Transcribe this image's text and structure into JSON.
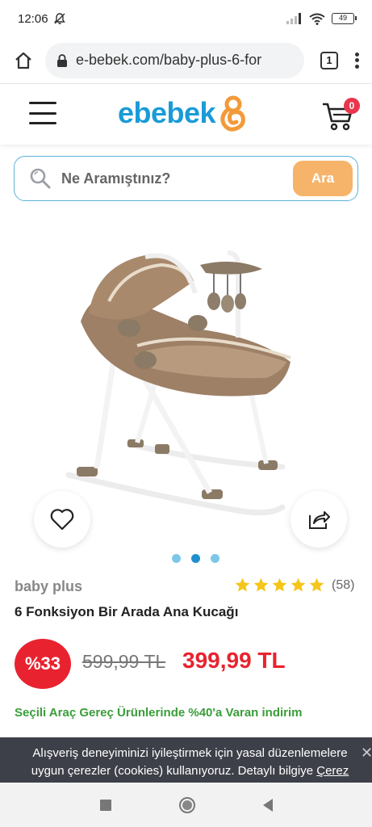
{
  "status_bar": {
    "time": "12:06",
    "battery": "49"
  },
  "browser": {
    "url": "e-bebek.com/baby-plus-6-for",
    "tab_count": "1"
  },
  "site": {
    "logo": "ebebek",
    "cart_count": "0",
    "brand_color": "#1a9bd7",
    "accent_color": "#f29a3a"
  },
  "search": {
    "placeholder": "Ne Aramıştınız?",
    "button_label": "Ara"
  },
  "gallery": {
    "dots": 3,
    "active_index": 1
  },
  "product": {
    "brand": "baby plus",
    "rating": 5,
    "review_count": "(58)",
    "title": "6 Fonksiyon Bir Arada Ana Kucağı",
    "discount": "%33",
    "old_price": "599,99 TL",
    "price": "399,99 TL",
    "promo": "Seçili Araç Gereç Ürünlerinde %40'a Varan indirim"
  },
  "cookie": {
    "text": "Alışveriş deneyiminizi iyileştirmek için yasal düzenlemelere uygun çerezler (cookies) kullanıyoruz. Detaylı bilgiye",
    "link": "Çerez"
  }
}
